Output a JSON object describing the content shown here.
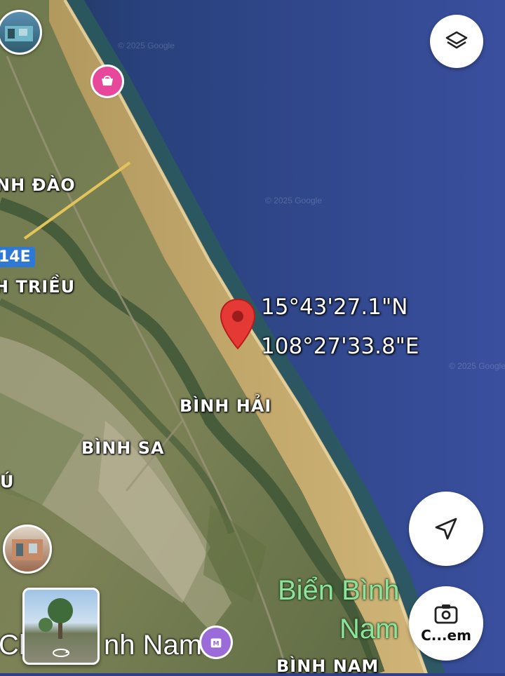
{
  "map": {
    "type": "satellite",
    "watermark": "© 2025 Google",
    "route_shield": "14E",
    "place_labels": [
      "NH ĐÀO",
      "H TRIỀU",
      "BÌNH HẢI",
      "BÌNH SA",
      "Ú",
      "BÌNH NAM"
    ],
    "area_label_line1": "Biển Bình",
    "area_label_line2": "Nam",
    "bottom_label_left": "Ch",
    "bottom_label_right": "nh Nam"
  },
  "pin": {
    "latitude": "15°43'27.1\"N",
    "longitude": "108°27'33.8\"E",
    "color": "#e53935"
  },
  "controls": {
    "layers_icon": "layers-icon",
    "my_location_icon": "navigation-arrow-icon",
    "camera_label": "C...em",
    "camera_icon": "camera-search-icon"
  },
  "colors": {
    "sea": "#2e3f8c",
    "sand": "#c9a866",
    "poi_pink": "#e8489b",
    "poi_purple": "#9b6bd9",
    "route_blue": "#2f79d6"
  }
}
